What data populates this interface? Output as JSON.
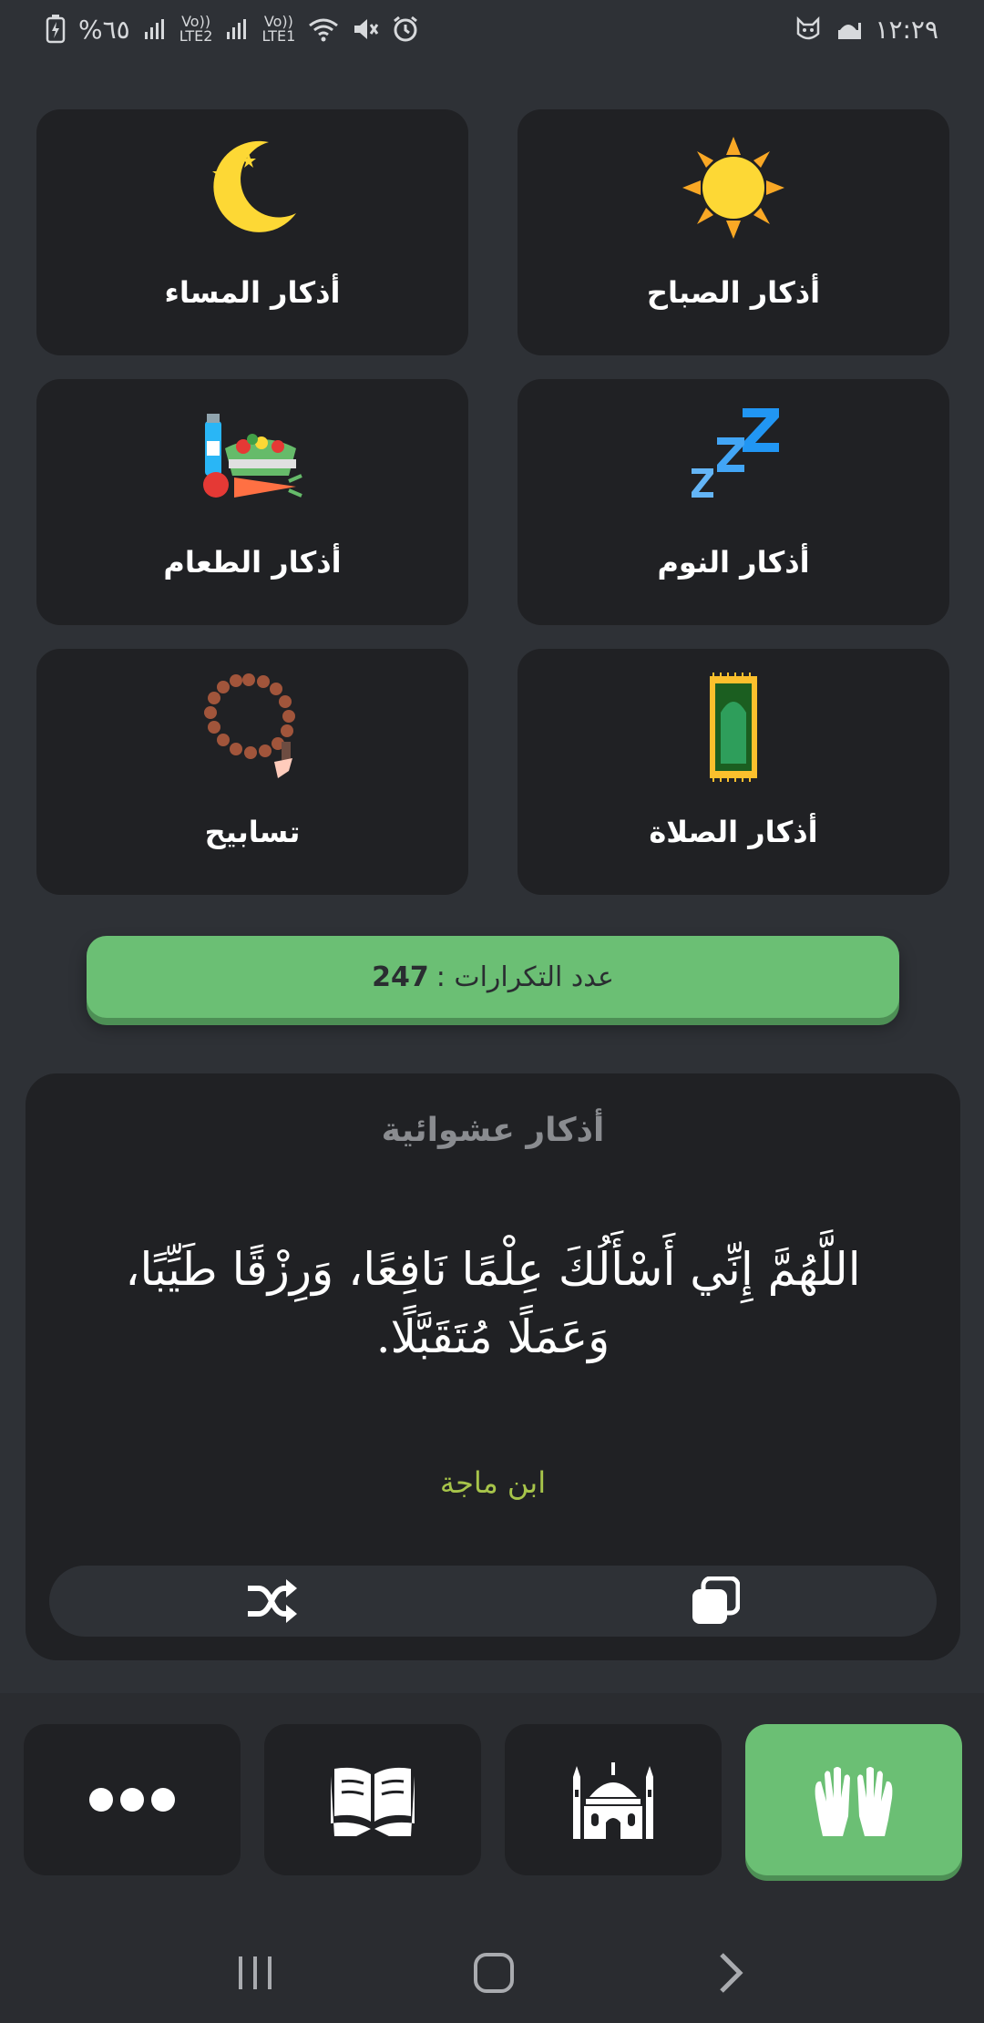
{
  "status_bar": {
    "time": "١٢:٢٩",
    "battery": "%٦٥",
    "sim1": "LTE1",
    "sim2": "LTE2",
    "volte": "Vo))"
  },
  "grid": {
    "cards": [
      {
        "label": "أذكار الصباح",
        "icon": "sun-icon"
      },
      {
        "label": "أذكار المساء",
        "icon": "moon-stars-icon"
      },
      {
        "label": "أذكار النوم",
        "icon": "zzz-icon"
      },
      {
        "label": "أذكار الطعام",
        "icon": "food-icon"
      },
      {
        "label": "أذكار الصلاة",
        "icon": "prayer-rug-icon"
      },
      {
        "label": "تسابيح",
        "icon": "prayer-beads-icon"
      }
    ]
  },
  "counter": {
    "label": "عدد التكرارات :",
    "value": "247"
  },
  "random": {
    "title": "أذكار عشوائية",
    "text": "اللَّهُمَّ إِنِّي أَسْأَلُكَ عِلْمًا نَافِعًا، وَرِزْقًا طَيِّبًا، وَعَمَلًا مُتَقَبَّلًا.",
    "source": "ابن ماجة",
    "actions": [
      "copy-icon",
      "shuffle-icon"
    ]
  },
  "bottom_nav": {
    "tabs": [
      "praying-hands-icon",
      "mosque-icon",
      "quran-icon",
      "more-icon"
    ],
    "active_tab": "praying-hands-icon"
  },
  "colors": {
    "background": "#2e3136",
    "card": "#202124",
    "accent_green": "#6bbf74",
    "source_green": "#a7c44a"
  }
}
